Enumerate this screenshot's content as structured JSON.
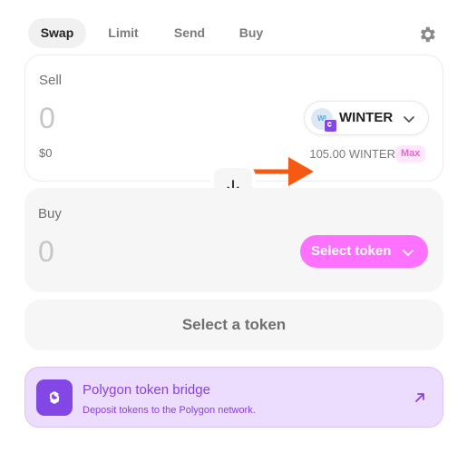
{
  "tabs": [
    {
      "label": "Swap",
      "active": true
    },
    {
      "label": "Limit",
      "active": false
    },
    {
      "label": "Send",
      "active": false
    },
    {
      "label": "Buy",
      "active": false
    }
  ],
  "settings_icon": "gear-icon",
  "sell": {
    "label": "Sell",
    "amount": "0",
    "usd_value": "$0",
    "token": {
      "symbol": "WINTER",
      "logo_text": "WI",
      "chain_icon": "polygon-icon"
    },
    "balance": "105.00 WINTER",
    "max_label": "Max"
  },
  "switch_icon": "arrow-down-icon",
  "buy": {
    "label": "Buy",
    "amount": "0",
    "select_label": "Select token"
  },
  "action_button": "Select a token",
  "bridge": {
    "title": "Polygon token bridge",
    "subtitle": "Deposit tokens to the Polygon network.",
    "icon": "polygon-icon",
    "arrow_icon": "external-arrow-icon"
  },
  "colors": {
    "accent_pink": "#fc72ff",
    "polygon_purple": "#8247e5",
    "annotation_orange": "#f55a12",
    "bridge_background": "#ecdcfd"
  }
}
